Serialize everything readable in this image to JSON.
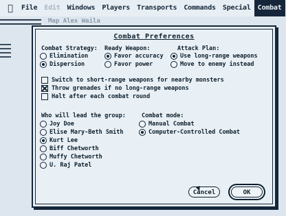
{
  "menubar": {
    "apple_glyph": "",
    "items": [
      "File",
      "Edit",
      "Windows",
      "Players",
      "Transports",
      "Commands",
      "Special",
      "Combat"
    ]
  },
  "background": {
    "faint_text": "Map Alex Waila"
  },
  "dialog": {
    "title": "Combat Preferences",
    "combat_strategy": {
      "label": "Combat Strategy:",
      "options": [
        "Elimination",
        "Dispersion"
      ],
      "selected": "Dispersion"
    },
    "ready_weapon": {
      "label": "Ready Weapon:",
      "options": [
        "Favor accuracy",
        "Favor power"
      ],
      "selected": "Favor accuracy"
    },
    "attack_plan": {
      "label": "Attack Plan:",
      "options": [
        "Use long-range weapons",
        "Move to enemy instead"
      ],
      "selected": "Use long-range weapons"
    },
    "checkboxes": [
      {
        "label": "Switch to short-range weapons for nearby monsters",
        "checked": false
      },
      {
        "label": "Throw grenades if no long-range weapons",
        "checked": true
      },
      {
        "label": "Halt after each combat round",
        "checked": false
      }
    ],
    "leader": {
      "label": "Who will lead the group:",
      "options": [
        "Joy Doe",
        "Elise Mary-Beth Smith",
        "Kurt Lee",
        "Biff Chetworth",
        "Muffy Chetworth",
        "U. Raj Patel"
      ],
      "selected": "Kurt Lee"
    },
    "combat_mode": {
      "label": "Combat mode:",
      "options": [
        "Manual Combat",
        "Computer-Controlled Combat"
      ],
      "selected": "Computer-Controlled Combat"
    },
    "buttons": {
      "cancel": "Cancel",
      "ok": "OK"
    }
  }
}
